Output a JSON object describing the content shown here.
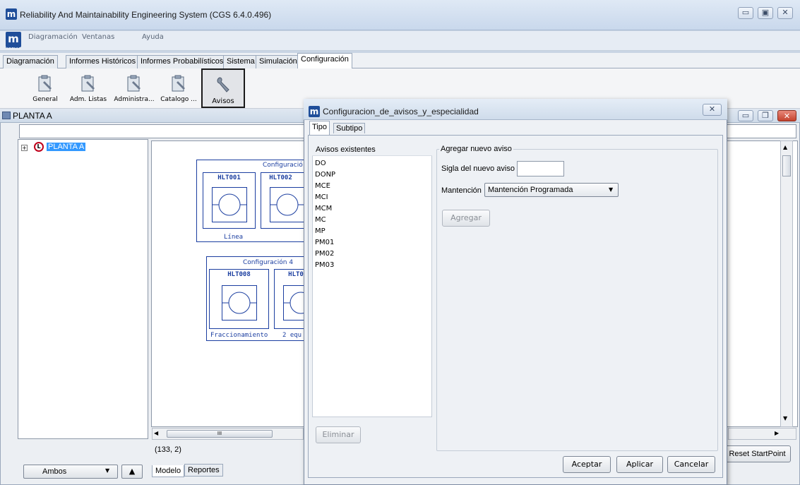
{
  "window": {
    "title": "Reliability And Maintainability Engineering System (CGS 6.4.0.496)",
    "logo": "m"
  },
  "menubar": {
    "items": [
      "Diagramación",
      "Ventanas",
      "Ayuda"
    ],
    "logo_sub": "RAMES"
  },
  "main_tabs": [
    {
      "label": "Diagramación"
    },
    {
      "label": "Informes Históricos"
    },
    {
      "label": "Informes Probabilísticos"
    },
    {
      "label": "Sistema"
    },
    {
      "label": "Simulación"
    },
    {
      "label": "Configuración",
      "active": true
    }
  ],
  "toolbar": {
    "items": [
      {
        "label": "General",
        "icon": "clipboard-wrench-icon"
      },
      {
        "label": "Adm. Listas",
        "icon": "clipboard-wrench-icon"
      },
      {
        "label": "Administra...",
        "icon": "clipboard-wrench-icon"
      },
      {
        "label": "Catalogo ...",
        "icon": "clipboard-wrench-icon"
      },
      {
        "label": "Avisos",
        "icon": "wrench-icon",
        "active": true
      }
    ]
  },
  "planta": {
    "title": "PLANTA A",
    "tree_root": "PLANTA A",
    "coords": "(133, 2)",
    "filter_select": "Ambos",
    "bottom_tabs": [
      "Modelo",
      "Reportes"
    ],
    "reset_button": "Reset StartPoint",
    "scroll_thumb": "III"
  },
  "diagram": {
    "config1": {
      "title": "Configuració",
      "blocks": [
        "HLT001",
        "HLT002"
      ],
      "footer": "Línea"
    },
    "config4": {
      "title": "Configuración 4",
      "blocks": [
        "HLT008",
        "HLT0"
      ],
      "footer_left": "Fraccionamiento",
      "footer_right": "2 equ"
    }
  },
  "dialog": {
    "title": "Configuracion_de_avisos_y_especialidad",
    "tabs": [
      "Tipo",
      "Subtipo"
    ],
    "existing_label": "Avisos existentes",
    "existing": [
      "DO",
      "DONP",
      "MCE",
      "MCI",
      "MCM",
      "MC",
      "MP",
      "PM01",
      "PM02",
      "PM03"
    ],
    "new_group": "Agregar nuevo aviso",
    "sigla_label": "Sigla del nuevo aviso",
    "sigla_value": "",
    "mantencion_label": "Mantención",
    "mantencion_value": "Mantención Programada",
    "add_button": "Agregar",
    "delete_button": "Eliminar",
    "ok_button": "Aceptar",
    "apply_button": "Aplicar",
    "cancel_button": "Cancelar",
    "close_glyph": "✕"
  },
  "colors": {
    "accent": "#1b3ea0",
    "selection": "#3399ff"
  }
}
